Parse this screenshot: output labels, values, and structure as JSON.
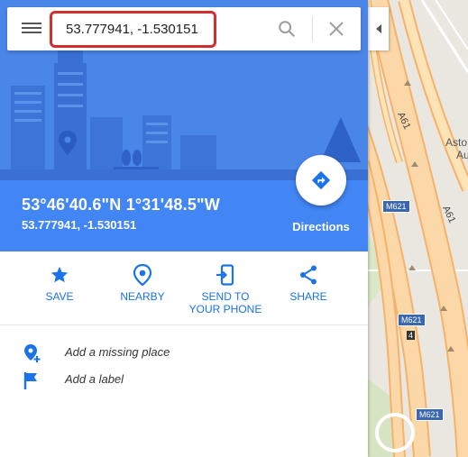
{
  "search": {
    "query": "53.777941, -1.530151"
  },
  "location": {
    "dms": "53°46'40.6\"N 1°31'48.5\"W",
    "decimal": "53.777941, -1.530151"
  },
  "directions": {
    "label": "Directions"
  },
  "actions": [
    {
      "label": "SAVE",
      "icon": "star-icon"
    },
    {
      "label": "NEARBY",
      "icon": "nearby-pin-icon"
    },
    {
      "label": "SEND TO YOUR PHONE",
      "icon": "send-to-phone-icon"
    },
    {
      "label": "SHARE",
      "icon": "share-icon"
    }
  ],
  "suggestions": [
    {
      "label": "Add a missing place",
      "icon": "add-place-icon"
    },
    {
      "label": "Add a label",
      "icon": "flag-icon"
    }
  ],
  "map": {
    "road_labels": [
      "A61",
      "A61"
    ],
    "motorway_shields": [
      "M621",
      "M621",
      "M621"
    ],
    "junction_label": "4",
    "place_label_lines": [
      "Asto",
      "Au"
    ]
  },
  "colors": {
    "accent": "#4285f4",
    "hero": "#4a86e8",
    "highlight_border": "#d32f2f",
    "action_blue": "#1a73e8",
    "map_land": "#e8e6dc",
    "map_road_fill": "#fbcb8f"
  }
}
